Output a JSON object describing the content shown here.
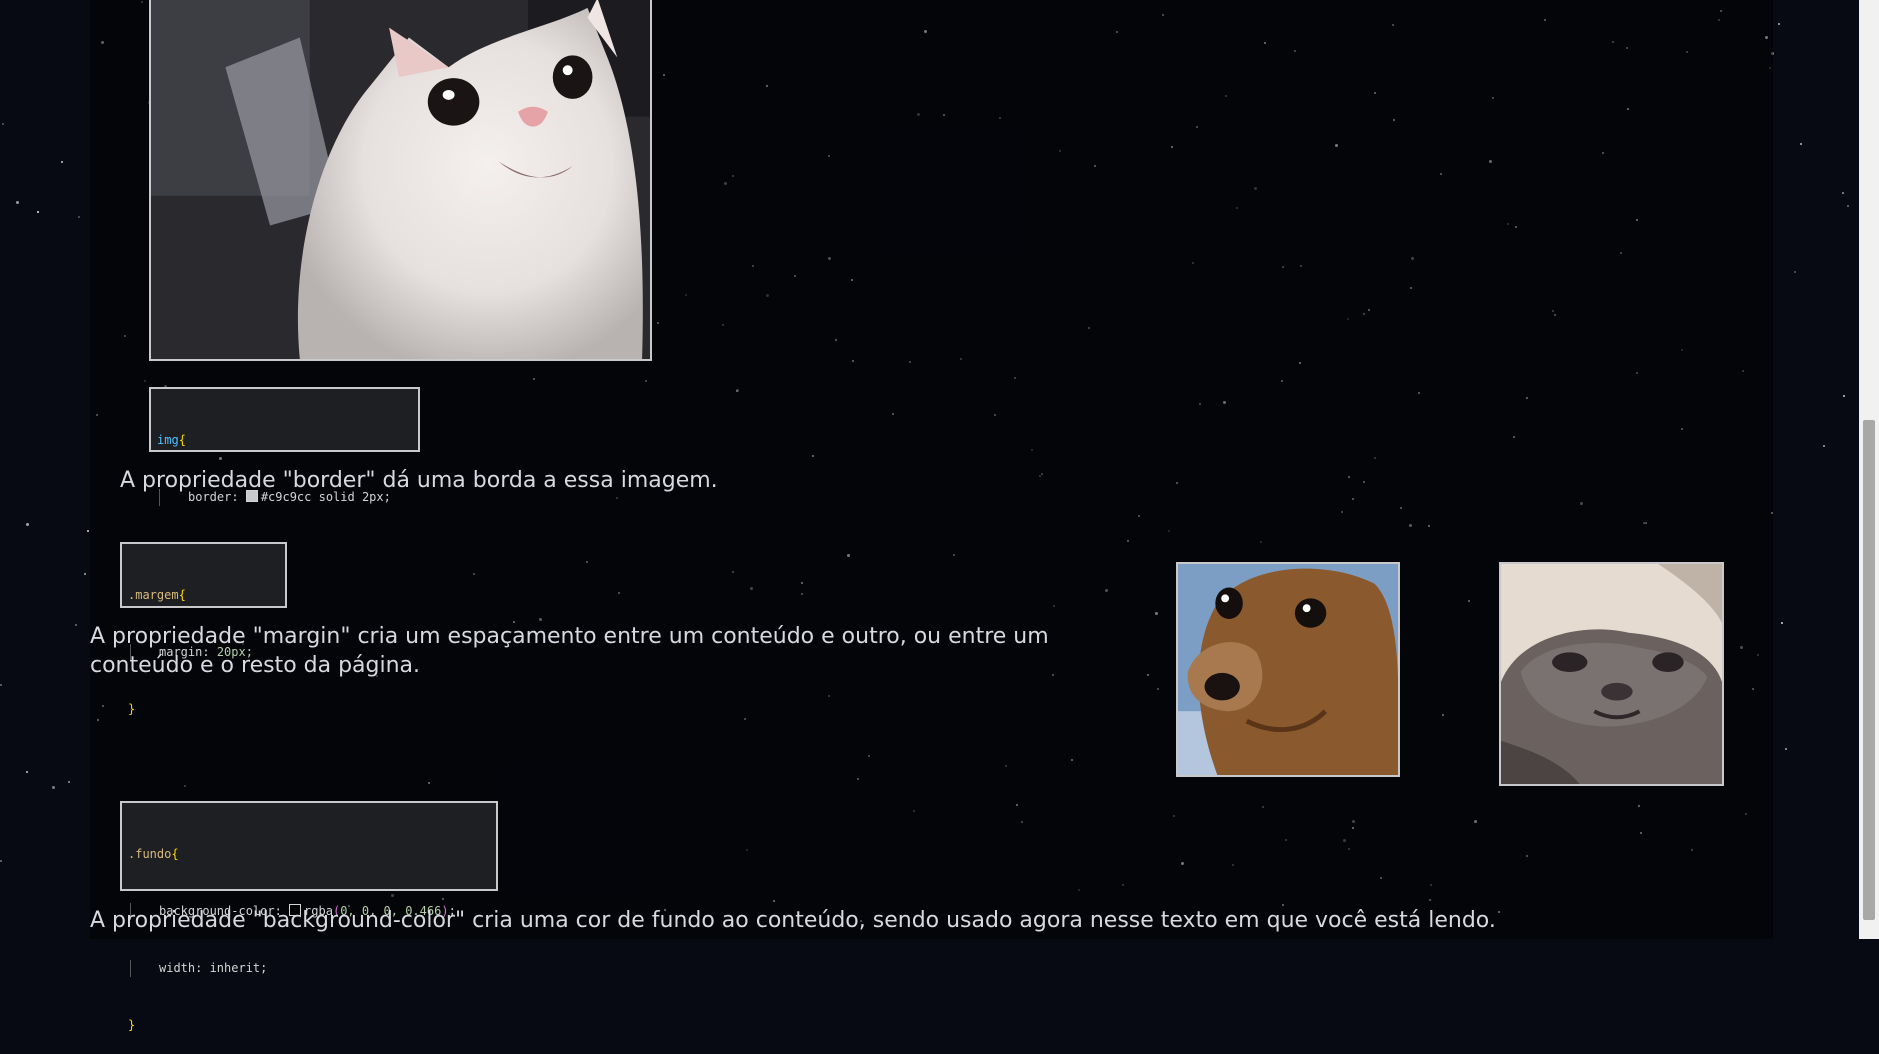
{
  "colors": {
    "page_bg": "#070a12",
    "border": "#c9c9cc",
    "text": "#d8d8e0",
    "code_bg": "#1e1f22"
  },
  "images": [
    {
      "name": "white-cat-photo",
      "subject": "white cat looking up"
    },
    {
      "name": "dog-photo",
      "subject": "brown dog close-up"
    },
    {
      "name": "grey-cat-photo",
      "subject": "grey cat face"
    }
  ],
  "code_blocks": {
    "img": {
      "selector": "img",
      "open": "{",
      "property": "border",
      "swatch_color": "#c9c9cc",
      "value": "#c9c9cc solid 2px;",
      "close": "}"
    },
    "margem": {
      "selector": ".margem",
      "open": "{",
      "property": "margin",
      "value": "20px;",
      "close": "}"
    },
    "fundo": {
      "selector": ".fundo",
      "open": "{",
      "property1": "background-color",
      "swatch_color": "rgba(0,0,0,0.466)",
      "fn_name": "rgba",
      "fn_args": "0, 0, 0, 0.466",
      "property2": "width",
      "value2": "inherit;",
      "close": "}"
    }
  },
  "paragraphs": {
    "border": "A propriedade \"border\" dá uma borda a essa imagem.",
    "margin": "A propriedade \"margin\" cria um espaçamento entre um conteúdo e outro, ou entre um conteúdo e o resto da página.",
    "background": "A propriedade \"background-color\" cria uma cor de fundo ao conteúdo, sendo usado agora nesse texto em que você está lendo."
  }
}
